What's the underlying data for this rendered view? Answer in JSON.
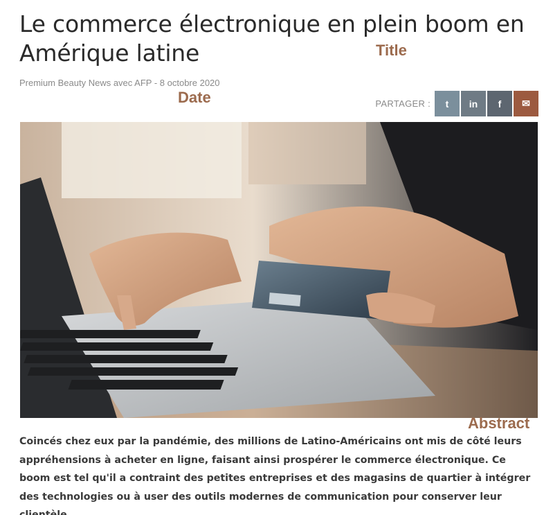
{
  "article": {
    "title": "Le commerce électronique en plein boom en Amérique latine",
    "byline": "Premium Beauty News avec AFP - 8 octobre 2020",
    "abstract": "Coincés chez eux par la pandémie, des millions de Latino-Américains ont mis de côté leurs appréhensions à acheter en ligne, faisant ainsi prospérer le commerce électronique. Ce boom est tel qu'il a contraint des petites entreprises et des magasins de quartier à intégrer des technologies ou à user des outils modernes de communication pour conserver leur clientèle."
  },
  "annotations": {
    "title_tag": "Title",
    "date_tag": "Date",
    "abstract_tag": "Abstract"
  },
  "share": {
    "label": "PARTAGER :",
    "buttons": [
      {
        "icon": "twitter-icon",
        "glyph": "t",
        "color": "#7b8f9c"
      },
      {
        "icon": "linkedin-icon",
        "glyph": "in",
        "color": "#6f7b85"
      },
      {
        "icon": "facebook-icon",
        "glyph": "f",
        "color": "#5d6670"
      },
      {
        "icon": "mail-icon",
        "glyph": "✉",
        "color": "#9c5a40"
      }
    ]
  },
  "colors": {
    "accent": "#9c6b4e",
    "text": "#2a2a2a",
    "muted": "#8a8a8a"
  }
}
